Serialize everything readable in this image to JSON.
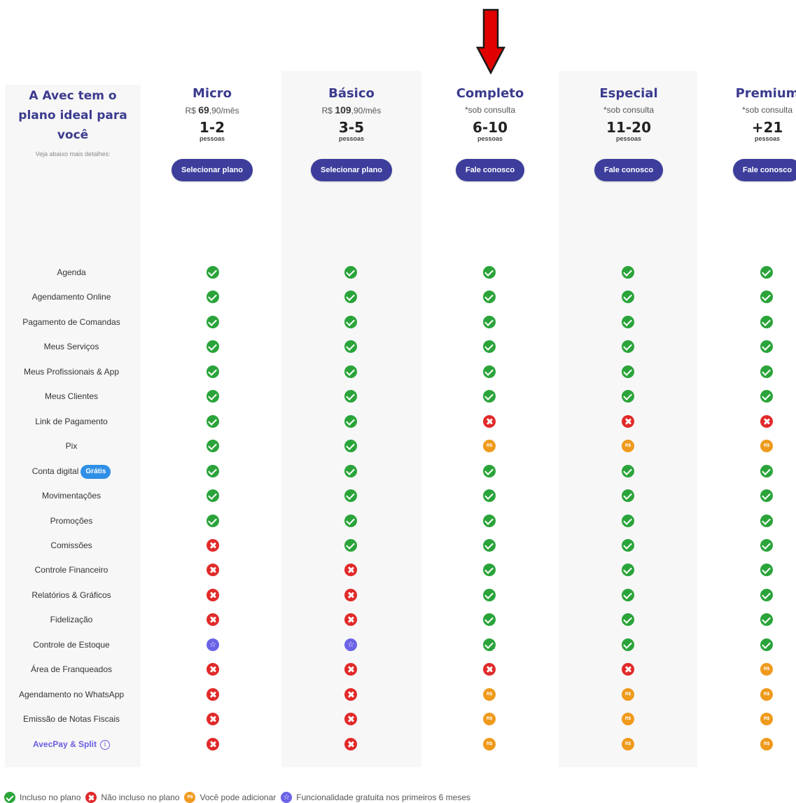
{
  "intro": {
    "title_lines": [
      "A Avec tem o",
      "plano ideal para",
      "você"
    ],
    "subtitle": "Veja abaixo mais detalhes:"
  },
  "plans": [
    {
      "name": "Micro",
      "price_prefix": "R$",
      "price_main": "69",
      "price_suffix": ",90/mês",
      "consult": "",
      "count": "1-2",
      "unit": "pessoas",
      "button": "Selecionar plano"
    },
    {
      "name": "Básico",
      "price_prefix": "R$",
      "price_main": "109",
      "price_suffix": ",90/mês",
      "consult": "",
      "count": "3-5",
      "unit": "pessoas",
      "button": "Selecionar plano"
    },
    {
      "name": "Completo",
      "price_prefix": "",
      "price_main": "",
      "price_suffix": "",
      "consult": "*sob consulta",
      "count": "6-10",
      "unit": "pessoas",
      "button": "Fale conosco"
    },
    {
      "name": "Especial",
      "price_prefix": "",
      "price_main": "",
      "price_suffix": "",
      "consult": "*sob consulta",
      "count": "11-20",
      "unit": "pessoas",
      "button": "Fale conosco"
    },
    {
      "name": "Premium",
      "price_prefix": "",
      "price_main": "",
      "price_suffix": "",
      "consult": "*sob consulta",
      "count": "+21",
      "unit": "pessoas",
      "button": "Fale conosco"
    }
  ],
  "features": [
    {
      "label": "Agenda",
      "values": [
        "check",
        "check",
        "check",
        "check",
        "check"
      ]
    },
    {
      "label": "Agendamento Online",
      "values": [
        "check",
        "check",
        "check",
        "check",
        "check"
      ]
    },
    {
      "label": "Pagamento de Comandas",
      "values": [
        "check",
        "check",
        "check",
        "check",
        "check"
      ]
    },
    {
      "label": "Meus Serviços",
      "values": [
        "check",
        "check",
        "check",
        "check",
        "check"
      ]
    },
    {
      "label": "Meus Profissionais & App",
      "values": [
        "check",
        "check",
        "check",
        "check",
        "check"
      ]
    },
    {
      "label": "Meus Clientes",
      "values": [
        "check",
        "check",
        "check",
        "check",
        "check"
      ]
    },
    {
      "label": "Link de Pagamento",
      "values": [
        "check",
        "check",
        "x",
        "x",
        "x"
      ]
    },
    {
      "label": "Pix",
      "values": [
        "check",
        "check",
        "add",
        "add",
        "add"
      ]
    },
    {
      "label": "Conta digital",
      "badge": "Grátis",
      "values": [
        "check",
        "check",
        "check",
        "check",
        "check"
      ]
    },
    {
      "label": "Movimentações",
      "values": [
        "check",
        "check",
        "check",
        "check",
        "check"
      ]
    },
    {
      "label": "Promoções",
      "values": [
        "check",
        "check",
        "check",
        "check",
        "check"
      ]
    },
    {
      "label": "Comissões",
      "values": [
        "x",
        "check",
        "check",
        "check",
        "check"
      ]
    },
    {
      "label": "Controle Financeiro",
      "values": [
        "x",
        "x",
        "check",
        "check",
        "check"
      ]
    },
    {
      "label": "Relatórios & Gráficos",
      "values": [
        "x",
        "x",
        "check",
        "check",
        "check"
      ]
    },
    {
      "label": "Fidelização",
      "values": [
        "x",
        "x",
        "check",
        "check",
        "check"
      ]
    },
    {
      "label": "Controle de Estoque",
      "values": [
        "free",
        "free",
        "check",
        "check",
        "check"
      ]
    },
    {
      "label": "Área de Franqueados",
      "values": [
        "x",
        "x",
        "x",
        "x",
        "add"
      ]
    },
    {
      "label": "Agendamento no WhatsApp",
      "values": [
        "x",
        "x",
        "add",
        "add",
        "add"
      ]
    },
    {
      "label": "Emissão de Notas Fiscais",
      "values": [
        "x",
        "x",
        "add",
        "add",
        "add"
      ]
    },
    {
      "label": "AvecPay & Split",
      "link": true,
      "info_icon": "info-icon",
      "values": [
        "x",
        "x",
        "add",
        "add",
        "add"
      ]
    }
  ],
  "legend": [
    {
      "icon": "check",
      "label": "Incluso no plano"
    },
    {
      "icon": "x",
      "label": "Não incluso no plano"
    },
    {
      "icon": "add",
      "label": "Você pode adicionar"
    },
    {
      "icon": "free",
      "label": "Funcionalidade gratuita nos primeiros 6 meses"
    }
  ],
  "colors": {
    "accent": "#3d3d9c",
    "included": "#2aa43a",
    "not_included": "#e12a2a",
    "addable": "#ef9a1c",
    "free_trial": "#6b62e6",
    "badge": "#2f8fe6",
    "arrow": "#e00000"
  },
  "icons": {
    "arrow": "down-arrow-icon"
  }
}
